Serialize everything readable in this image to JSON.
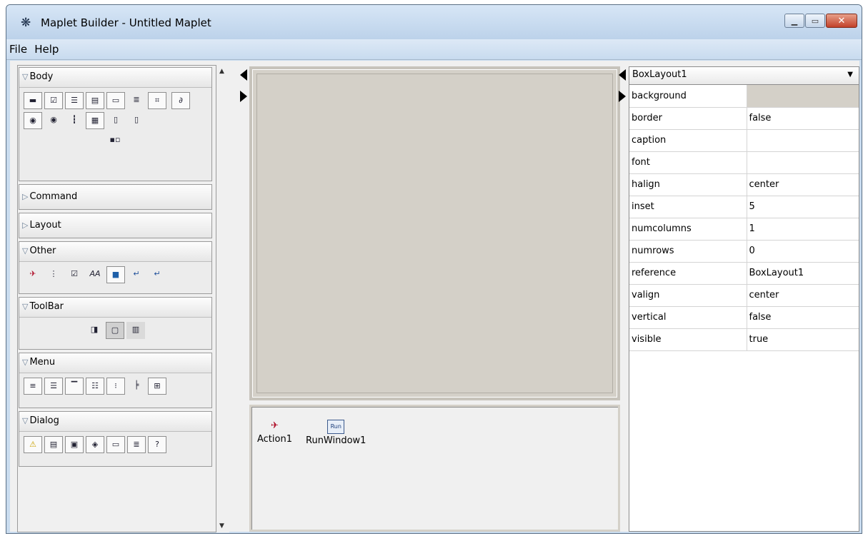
{
  "window": {
    "title": "Maplet Builder - Untitled Maplet",
    "controls": [
      "minimize",
      "maximize",
      "close"
    ],
    "accent": "#c9dcef"
  },
  "menubar": {
    "items": [
      "File",
      "Help"
    ]
  },
  "palette": {
    "sections": [
      {
        "label": "Body",
        "expanded": true
      },
      {
        "label": "Command",
        "expanded": false
      },
      {
        "label": "Layout",
        "expanded": false
      },
      {
        "label": "Other",
        "expanded": true
      },
      {
        "label": "ToolBar",
        "expanded": true
      },
      {
        "label": "Menu",
        "expanded": true
      },
      {
        "label": "Dialog",
        "expanded": true
      }
    ]
  },
  "nonvisual": {
    "items": [
      {
        "label": "Action1",
        "icon": "action-icon"
      },
      {
        "label": "RunWindow1",
        "icon": "run-window-icon",
        "badge": "Run"
      }
    ]
  },
  "properties": {
    "selected": "BoxLayout1",
    "rows": [
      {
        "key": "background",
        "value": ""
      },
      {
        "key": "border",
        "value": "false"
      },
      {
        "key": "caption",
        "value": ""
      },
      {
        "key": "font",
        "value": ""
      },
      {
        "key": "halign",
        "value": "center"
      },
      {
        "key": "inset",
        "value": "5"
      },
      {
        "key": "numcolumns",
        "value": "1"
      },
      {
        "key": "numrows",
        "value": "0"
      },
      {
        "key": "reference",
        "value": "BoxLayout1"
      },
      {
        "key": "valign",
        "value": "center"
      },
      {
        "key": "vertical",
        "value": "false"
      },
      {
        "key": "visible",
        "value": "true"
      }
    ],
    "background_color": "#d4d0c8"
  }
}
